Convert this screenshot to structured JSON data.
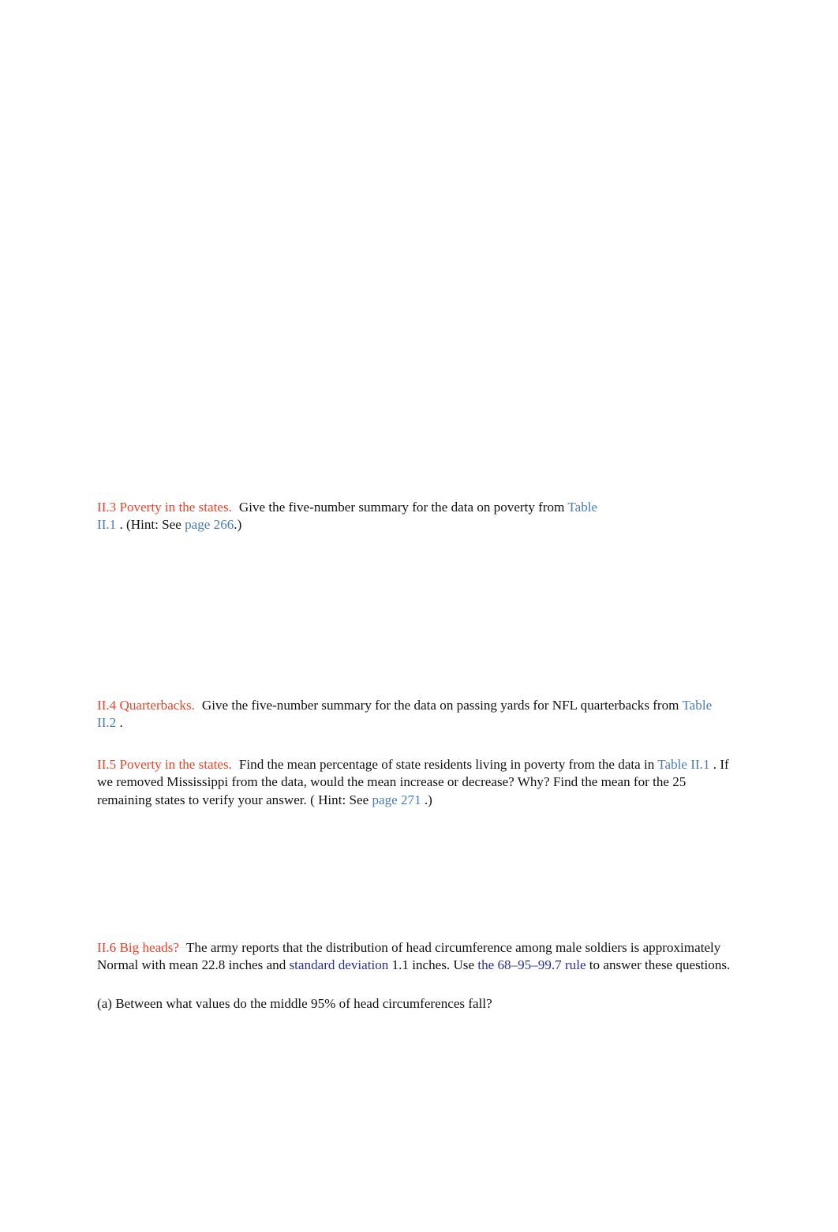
{
  "document": {
    "type": "textbook-exercise-page",
    "background_color": "#ffffff",
    "heading_color": "#E8442C",
    "reference_link_color": "#4A7CB5",
    "term_link_color": "#2B2F8C",
    "body_text_color": "#111111"
  },
  "exercises": [
    {
      "id": "II.3",
      "heading": "II.3 Poverty in the states.",
      "segments": [
        {
          "kind": "text",
          "value": "Give the five-number summary for the data on poverty from "
        },
        {
          "kind": "ref",
          "value": "Table II.1"
        },
        {
          "kind": "text",
          "value": " . (Hint: See "
        },
        {
          "kind": "ref",
          "value": "page 266"
        },
        {
          "kind": "text",
          "value": ".)"
        }
      ]
    },
    {
      "id": "II.4",
      "heading": "II.4 Quarterbacks.",
      "segments": [
        {
          "kind": "text",
          "value": "Give the five-number summary for the data on passing yards for NFL quarterbacks from "
        },
        {
          "kind": "ref",
          "value": "Table II.2"
        },
        {
          "kind": "text",
          "value": " ."
        }
      ]
    },
    {
      "id": "II.5",
      "heading": "II.5 Poverty in the states.",
      "segments": [
        {
          "kind": "text",
          "value": "Find the mean percentage of state residents living in poverty from the data in "
        },
        {
          "kind": "ref",
          "value": "Table II.1"
        },
        {
          "kind": "text",
          "value": " . If we removed Mississippi from the data, would the mean increase or decrease? Why? Find the mean for the 25 remaining states to verify your answer. ( Hint: See "
        },
        {
          "kind": "ref",
          "value": "page 271"
        },
        {
          "kind": "text",
          "value": " .)"
        }
      ]
    },
    {
      "id": "II.6",
      "heading": "II.6 Big heads?",
      "segments": [
        {
          "kind": "text",
          "value": "The army reports that the distribution of head circumference among male soldiers is approximately Normal with mean 22.8 inches and "
        },
        {
          "kind": "term",
          "value": "standard deviation"
        },
        {
          "kind": "text",
          "value": " 1.1 inches. Use "
        },
        {
          "kind": "term",
          "value": "the 68–95–99.7 rule"
        },
        {
          "kind": "text",
          "value": " to answer these questions."
        }
      ],
      "subparts": [
        {
          "label": "(a)",
          "text": "(a) Between what values do the middle 95% of head circumferences fall?"
        }
      ]
    }
  ]
}
